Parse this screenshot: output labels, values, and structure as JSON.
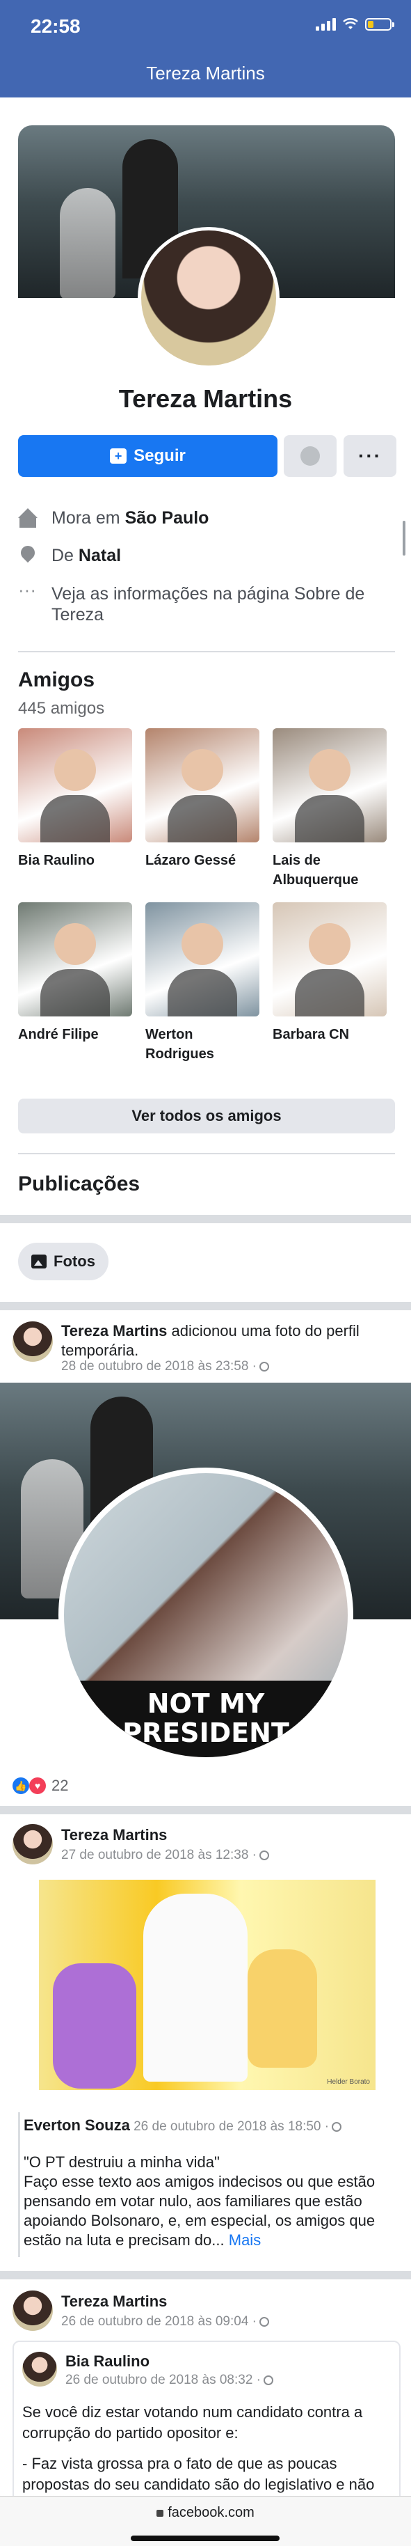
{
  "status": {
    "time": "22:58",
    "battery_fraction": 0.25
  },
  "header": {
    "title": "Tereza Martins"
  },
  "profile": {
    "name": "Tereza Martins",
    "follow_label": "Seguir",
    "more_label": "···",
    "lives_prefix": "Mora em ",
    "lives_city": "São Paulo",
    "from_prefix": "De ",
    "from_city": "Natal",
    "about_link": "Veja as informações na página Sobre de Tereza"
  },
  "friends": {
    "title": "Amigos",
    "count": "445 amigos",
    "items": [
      {
        "name": "Bia Raulino",
        "color": "#c98a7a"
      },
      {
        "name": "Lázaro Gessé",
        "color": "#b4846c"
      },
      {
        "name": "Lais de Albuquerque",
        "color": "#9a8b7d"
      },
      {
        "name": "André Filipe",
        "color": "#6f7a72"
      },
      {
        "name": "Werton Rodrigues",
        "color": "#7f93a0"
      },
      {
        "name": "Barbara CN",
        "color": "#d6c6b6"
      }
    ],
    "see_all_label": "Ver todos os amigos"
  },
  "posts_section": {
    "title": "Publicações",
    "photos_label": "Fotos"
  },
  "post1": {
    "author": "Tereza Martins",
    "action": " adicionou uma foto do perfil temporária.",
    "date": "28 de outubro de 2018 às 23:58 ·",
    "overlay_text": "NOT MY PRESIDENT",
    "reaction_count": "22"
  },
  "post2": {
    "author": "Tereza Martins",
    "date": "27 de outubro de 2018 às 12:38 ·",
    "photo_credit": "Helder Borato",
    "shared_author": "Everton Souza",
    "shared_date": " 26 de outubro de 2018 às 18:50 ·",
    "shared_quote": "\"O PT destruiu a minha vida\"",
    "shared_body": "Faço esse texto aos amigos indecisos ou que estão pensando em votar nulo, aos familiares que estão apoiando Bolsonaro, e, em especial, os amigos que estão na luta e precisam do...",
    "more_label": "Mais"
  },
  "post3": {
    "author": "Tereza Martins",
    "date": "26 de outubro de 2018 às 09:04 ·",
    "inner_author": "Bia Raulino",
    "inner_date": "26 de outubro de 2018 às 08:32 ·",
    "inner_text_1": "Se você diz estar votando num candidato contra a corrupção do partido opositor e:",
    "inner_text_2": "- Faz vista grossa pra o fato de que as poucas propostas do seu candidato são do legislativo e não do executivo ( de modo que muitas ele não tem..."
  },
  "browser": {
    "url": "facebook.com"
  }
}
